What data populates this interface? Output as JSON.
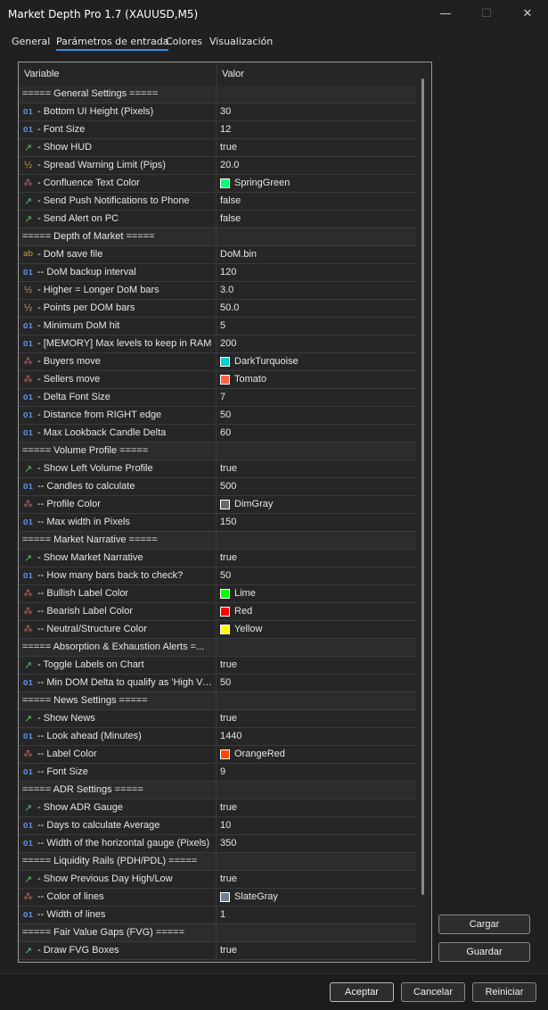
{
  "window": {
    "title": "Market Depth Pro 1.7 (XAUUSD,M5)",
    "minimize": "—",
    "maximize": "☐",
    "close": "✕"
  },
  "tabs": [
    "General",
    "Parámetros de entrada",
    "Colores",
    "Visualización"
  ],
  "table": {
    "headers": {
      "variable": "Variable",
      "value": "Valor"
    },
    "rows": [
      {
        "type": "section",
        "name": "===== General Settings ====="
      },
      {
        "type": "int",
        "icon": "01",
        "name": " - Bottom UI Height (Pixels)",
        "value": "30"
      },
      {
        "type": "int",
        "icon": "01",
        "name": " - Font Size",
        "value": "12"
      },
      {
        "type": "bool",
        "icon": "↗",
        "name": " - Show HUD",
        "value": "true"
      },
      {
        "type": "dbl",
        "icon": "½",
        "name": " - Spread Warning Limit (Pips)",
        "value": "20.0"
      },
      {
        "type": "color",
        "icon": "⁂",
        "name": " - Confluence Text Color",
        "value": "SpringGreen",
        "swatch": "#00ff7f"
      },
      {
        "type": "bool",
        "icon": "↗",
        "name": " - Send Push Notifications to Phone",
        "value": "false"
      },
      {
        "type": "bool",
        "icon": "↗",
        "name": " - Send Alert on PC",
        "value": "false"
      },
      {
        "type": "section",
        "name": "===== Depth of Market ====="
      },
      {
        "type": "str",
        "icon": "ab",
        "name": " - DoM save file",
        "value": "DoM.bin"
      },
      {
        "type": "int",
        "icon": "01",
        "name": " -- DoM backup interval",
        "value": "120"
      },
      {
        "type": "dbl",
        "icon": "½",
        "name": " - Higher = Longer DoM bars",
        "value": "3.0"
      },
      {
        "type": "dbl",
        "icon": "½",
        "name": " - Points per DOM bars",
        "value": "50.0"
      },
      {
        "type": "int",
        "icon": "01",
        "name": " - Minimum DoM hit",
        "value": "5"
      },
      {
        "type": "int",
        "icon": "01",
        "name": " - [MEMORY] Max levels to keep in RAM",
        "value": "200"
      },
      {
        "type": "color",
        "icon": "⁂",
        "name": " - Buyers move",
        "value": "DarkTurquoise",
        "swatch": "#00ced1"
      },
      {
        "type": "color",
        "icon": "⁂",
        "name": " - Sellers move",
        "value": "Tomato",
        "swatch": "#ff6347"
      },
      {
        "type": "int",
        "icon": "01",
        "name": " - Delta Font Size",
        "value": "7"
      },
      {
        "type": "int",
        "icon": "01",
        "name": " - Distance from RIGHT edge",
        "value": "50"
      },
      {
        "type": "int",
        "icon": "01",
        "name": " - Max Lookback Candle Delta",
        "value": "60"
      },
      {
        "type": "section",
        "name": "===== Volume Profile ====="
      },
      {
        "type": "bool",
        "icon": "↗",
        "name": " - Show Left Volume Profile",
        "value": "true"
      },
      {
        "type": "int",
        "icon": "01",
        "name": " -- Candles to calculate",
        "value": "500"
      },
      {
        "type": "color",
        "icon": "⁂",
        "name": " -- Profile Color",
        "value": "DimGray",
        "swatch": "#696969"
      },
      {
        "type": "int",
        "icon": "01",
        "name": " -- Max width in Pixels",
        "value": "150"
      },
      {
        "type": "section",
        "name": "===== Market Narrative ====="
      },
      {
        "type": "bool",
        "icon": "↗",
        "name": " - Show Market Narrative",
        "value": "true"
      },
      {
        "type": "int",
        "icon": "01",
        "name": " -- How many bars back to check?",
        "value": "50"
      },
      {
        "type": "color",
        "icon": "⁂",
        "name": " -- Bullish Label Color",
        "value": "Lime",
        "swatch": "#00ff00"
      },
      {
        "type": "color",
        "icon": "⁂",
        "name": " -- Bearish Label Color",
        "value": "Red",
        "swatch": "#ff0000"
      },
      {
        "type": "color",
        "icon": "⁂",
        "name": " -- Neutral/Structure Color",
        "value": "Yellow",
        "swatch": "#ffff00"
      },
      {
        "type": "section",
        "name": "===== Absorption & Exhaustion Alerts =..."
      },
      {
        "type": "bool",
        "icon": "↗",
        "name": " - Toggle Labels on Chart",
        "value": "true"
      },
      {
        "type": "int",
        "icon": "01",
        "name": " -- Min DOM Delta to qualify as 'High Vo...",
        "value": "50"
      },
      {
        "type": "section",
        "name": "===== News Settings ====="
      },
      {
        "type": "bool",
        "icon": "↗",
        "name": " - Show News",
        "value": "true"
      },
      {
        "type": "int",
        "icon": "01",
        "name": " -- Look ahead (Minutes)",
        "value": "1440"
      },
      {
        "type": "color",
        "icon": "⁂",
        "name": " -- Label Color",
        "value": "OrangeRed",
        "swatch": "#ff4500"
      },
      {
        "type": "int",
        "icon": "01",
        "name": " -- Font Size",
        "value": "9"
      },
      {
        "type": "section",
        "name": "===== ADR Settings ====="
      },
      {
        "type": "bool",
        "icon": "↗",
        "name": " - Show ADR Gauge",
        "value": "true"
      },
      {
        "type": "int",
        "icon": "01",
        "name": " -- Days to calculate Average",
        "value": "10"
      },
      {
        "type": "int",
        "icon": "01",
        "name": " -- Width of the horizontal gauge (Pixels)",
        "value": "350"
      },
      {
        "type": "section",
        "name": "===== Liquidity Rails (PDH/PDL) ====="
      },
      {
        "type": "bool",
        "icon": "↗",
        "name": " - Show Previous Day High/Low",
        "value": "true"
      },
      {
        "type": "color",
        "icon": "⁂",
        "name": " -- Color of lines",
        "value": "SlateGray",
        "swatch": "#708090"
      },
      {
        "type": "int",
        "icon": "01",
        "name": " -- Width of lines",
        "value": "1"
      },
      {
        "type": "section",
        "name": "===== Fair Value Gaps (FVG) ====="
      },
      {
        "type": "bool",
        "icon": "↗",
        "name": " - Draw FVG Boxes",
        "value": "true"
      }
    ]
  },
  "side_buttons": {
    "load": "Cargar",
    "save": "Guardar"
  },
  "footer_buttons": {
    "accept": "Aceptar",
    "cancel": "Cancelar",
    "reset": "Reiniciar"
  }
}
